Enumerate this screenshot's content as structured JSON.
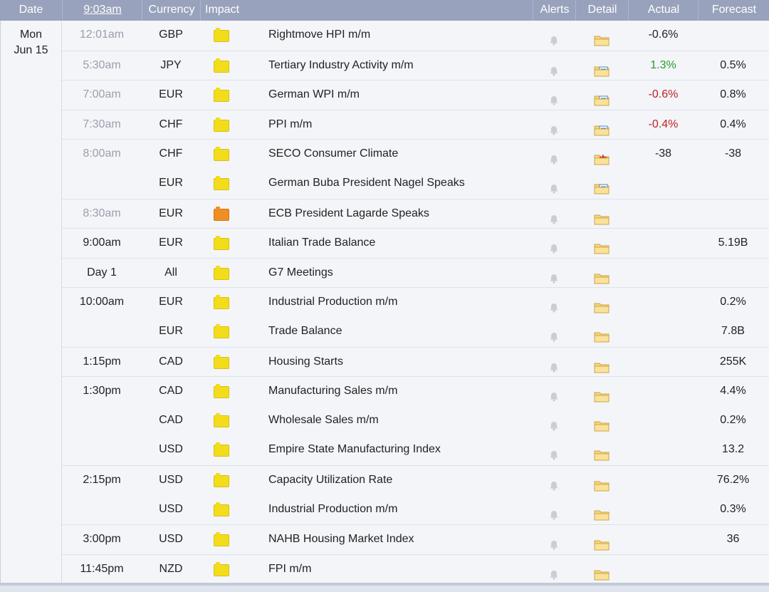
{
  "header": {
    "date": "Date",
    "clock": "9:03am",
    "currency": "Currency",
    "impact": "Impact",
    "alerts": "Alerts",
    "detail": "Detail",
    "actual": "Actual",
    "forecast": "Forecast"
  },
  "day": {
    "weekday": "Mon",
    "date": "Jun 15"
  },
  "colors": {
    "header_bg": "#99a2bc",
    "positive": "#2b9a2b",
    "negative": "#c21f1f",
    "impact_low": "#f3dd1a",
    "impact_medium": "#ef8f22"
  },
  "rows": [
    {
      "time": "12:01am",
      "past": true,
      "currency": "GBP",
      "impact": "low",
      "event": "Rightmove HPI m/m",
      "detail_icon": "folder-icon",
      "actual": "-0.6%",
      "actual_dir": "",
      "forecast": ""
    },
    {
      "time": "5:30am",
      "past": true,
      "currency": "JPY",
      "impact": "low",
      "event": "Tertiary Industry Activity m/m",
      "detail_icon": "folder-doc-icon",
      "actual": "1.3%",
      "actual_dir": "up",
      "forecast": "0.5%"
    },
    {
      "time": "7:00am",
      "past": true,
      "currency": "EUR",
      "impact": "low",
      "event": "German WPI m/m",
      "detail_icon": "folder-doc-icon",
      "actual": "-0.6%",
      "actual_dir": "down",
      "forecast": "0.8%"
    },
    {
      "time": "7:30am",
      "past": true,
      "currency": "CHF",
      "impact": "low",
      "event": "PPI m/m",
      "detail_icon": "folder-doc-icon",
      "actual": "-0.4%",
      "actual_dir": "down",
      "forecast": "0.4%"
    },
    {
      "time": "8:00am",
      "past": true,
      "currency": "CHF",
      "impact": "low",
      "event": "SECO Consumer Climate",
      "detail_icon": "folder-star-icon",
      "actual": "-38",
      "actual_dir": "",
      "forecast": "-38"
    },
    {
      "time": "",
      "past": true,
      "currency": "EUR",
      "impact": "low",
      "event": "German Buba President Nagel Speaks",
      "detail_icon": "folder-doc-icon",
      "actual": "",
      "actual_dir": "",
      "forecast": ""
    },
    {
      "time": "8:30am",
      "past": true,
      "currency": "EUR",
      "impact": "medium",
      "event": "ECB President Lagarde Speaks",
      "detail_icon": "folder-icon",
      "actual": "",
      "actual_dir": "",
      "forecast": ""
    },
    {
      "time": "9:00am",
      "past": false,
      "currency": "EUR",
      "impact": "low",
      "event": "Italian Trade Balance",
      "detail_icon": "folder-icon",
      "actual": "",
      "actual_dir": "",
      "forecast": "5.19B"
    },
    {
      "time": "Day 1",
      "past": false,
      "currency": "All",
      "impact": "low",
      "event": "G7 Meetings",
      "detail_icon": "folder-icon",
      "actual": "",
      "actual_dir": "",
      "forecast": ""
    },
    {
      "time": "10:00am",
      "past": false,
      "currency": "EUR",
      "impact": "low",
      "event": "Industrial Production m/m",
      "detail_icon": "folder-icon",
      "actual": "",
      "actual_dir": "",
      "forecast": "0.2%"
    },
    {
      "time": "",
      "past": false,
      "currency": "EUR",
      "impact": "low",
      "event": "Trade Balance",
      "detail_icon": "folder-icon",
      "actual": "",
      "actual_dir": "",
      "forecast": "7.8B"
    },
    {
      "time": "1:15pm",
      "past": false,
      "currency": "CAD",
      "impact": "low",
      "event": "Housing Starts",
      "detail_icon": "folder-icon",
      "actual": "",
      "actual_dir": "",
      "forecast": "255K"
    },
    {
      "time": "1:30pm",
      "past": false,
      "currency": "CAD",
      "impact": "low",
      "event": "Manufacturing Sales m/m",
      "detail_icon": "folder-icon",
      "actual": "",
      "actual_dir": "",
      "forecast": "4.4%"
    },
    {
      "time": "",
      "past": false,
      "currency": "CAD",
      "impact": "low",
      "event": "Wholesale Sales m/m",
      "detail_icon": "folder-icon",
      "actual": "",
      "actual_dir": "",
      "forecast": "0.2%"
    },
    {
      "time": "",
      "past": false,
      "currency": "USD",
      "impact": "low",
      "event": "Empire State Manufacturing Index",
      "detail_icon": "folder-icon",
      "actual": "",
      "actual_dir": "",
      "forecast": "13.2"
    },
    {
      "time": "2:15pm",
      "past": false,
      "currency": "USD",
      "impact": "low",
      "event": "Capacity Utilization Rate",
      "detail_icon": "folder-icon",
      "actual": "",
      "actual_dir": "",
      "forecast": "76.2%"
    },
    {
      "time": "",
      "past": false,
      "currency": "USD",
      "impact": "low",
      "event": "Industrial Production m/m",
      "detail_icon": "folder-icon",
      "actual": "",
      "actual_dir": "",
      "forecast": "0.3%"
    },
    {
      "time": "3:00pm",
      "past": false,
      "currency": "USD",
      "impact": "low",
      "event": "NAHB Housing Market Index",
      "detail_icon": "folder-icon",
      "actual": "",
      "actual_dir": "",
      "forecast": "36"
    },
    {
      "time": "11:45pm",
      "past": false,
      "currency": "NZD",
      "impact": "low",
      "event": "FPI m/m",
      "detail_icon": "folder-icon",
      "actual": "",
      "actual_dir": "",
      "forecast": ""
    }
  ]
}
